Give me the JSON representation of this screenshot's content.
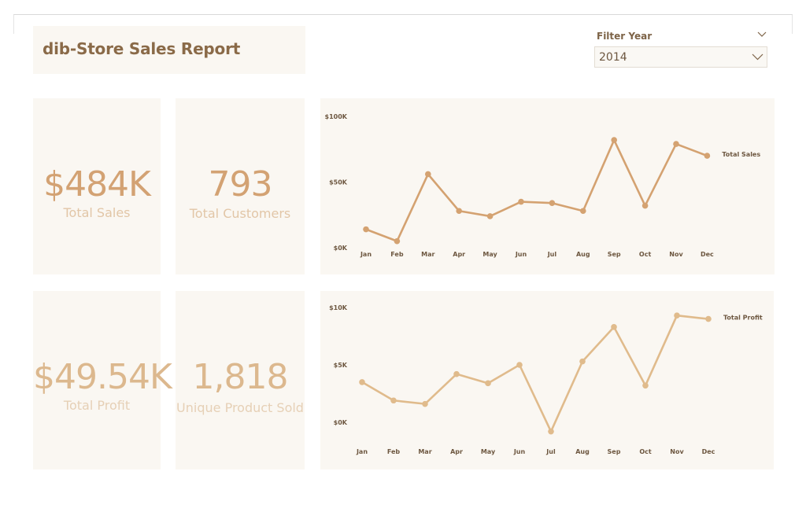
{
  "title": "dib-Store Sales Report",
  "filter": {
    "label": "Filter Year",
    "selected": "2014"
  },
  "kpis": {
    "total_sales": {
      "value": "$484K",
      "label": "Total Sales"
    },
    "total_customers": {
      "value": "793",
      "label": "Total Customers"
    },
    "total_profit": {
      "value": "$49.54K",
      "label": "Total Profit"
    },
    "unique_products": {
      "value": "1,818",
      "label": "Unique Product Sold"
    }
  },
  "colors": {
    "line_sales": "#d4a271",
    "line_profit": "#e0bb8c",
    "panel": "#faf7f2"
  },
  "chart_data": [
    {
      "type": "line",
      "x": [
        "Jan",
        "Feb",
        "Mar",
        "Apr",
        "May",
        "Jun",
        "Jul",
        "Aug",
        "Sep",
        "Oct",
        "Nov",
        "Dec"
      ],
      "series": [
        {
          "name": "Total Sales",
          "values": [
            14,
            5,
            56,
            28,
            24,
            35,
            34,
            28,
            82,
            32,
            79,
            70
          ]
        }
      ],
      "yticks": [
        "$0K",
        "$50K",
        "$100K"
      ],
      "ylim": [
        0,
        100
      ],
      "legend": "right-end"
    },
    {
      "type": "line",
      "x": [
        "Jan",
        "Feb",
        "Mar",
        "Apr",
        "May",
        "Jun",
        "Jul",
        "Aug",
        "Sep",
        "Oct",
        "Nov",
        "Dec"
      ],
      "series": [
        {
          "name": "Total Profit",
          "values": [
            3.5,
            1.9,
            1.6,
            4.2,
            3.4,
            5.0,
            -0.8,
            5.3,
            8.3,
            3.2,
            9.3,
            9.0
          ]
        }
      ],
      "yticks": [
        "$0K",
        "$5K",
        "$10K"
      ],
      "ylim": [
        0,
        10
      ],
      "legend": "right-end"
    }
  ]
}
